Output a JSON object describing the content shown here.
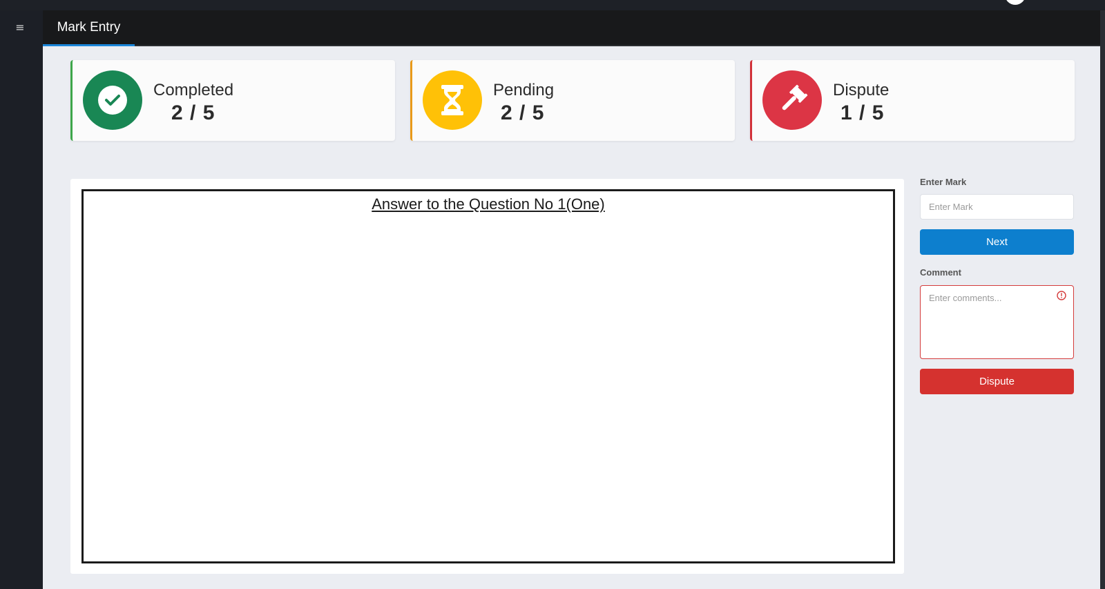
{
  "header": {
    "menu_icon": "hamburger-icon",
    "tab_label": "Mark Entry"
  },
  "stats": [
    {
      "label": "Completed",
      "value": "2 / 5",
      "icon": "check-circle-icon",
      "color": "#198754"
    },
    {
      "label": "Pending",
      "value": "2 / 5",
      "icon": "hourglass-icon",
      "color": "#ffc107"
    },
    {
      "label": "Dispute",
      "value": "1 / 5",
      "icon": "gavel-icon",
      "color": "#dc3545"
    }
  ],
  "answer": {
    "title": "Answer to the Question No 1(One)"
  },
  "form": {
    "mark_label": "Enter Mark",
    "mark_placeholder": "Enter Mark",
    "next_label": "Next",
    "comment_label": "Comment",
    "comment_placeholder": "Enter comments...",
    "dispute_label": "Dispute"
  },
  "colors": {
    "accent": "#0d7fce",
    "danger": "#d5322f"
  }
}
